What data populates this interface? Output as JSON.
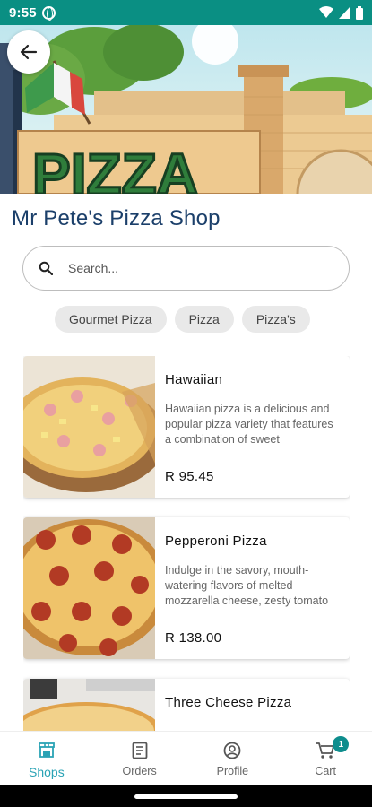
{
  "status_bar": {
    "time": "9:55",
    "globe_icon": "globe-icon",
    "wifi_icon": "wifi-icon",
    "signal_icon": "signal-icon",
    "battery_icon": "battery-icon"
  },
  "hero": {
    "banner_text": "PIZZA",
    "back_icon": "arrow-left-icon"
  },
  "shop": {
    "title": "Mr Pete's Pizza Shop"
  },
  "search": {
    "placeholder": "Search...",
    "value": "",
    "icon": "search-icon"
  },
  "chips": [
    "Gourmet Pizza",
    "Pizza",
    "Pizza's"
  ],
  "products": [
    {
      "name": "Hawaiian",
      "description": "Hawaiian pizza is a delicious and popular pizza variety that features a combination of sweet",
      "price": "R 95.45"
    },
    {
      "name": "Pepperoni Pizza",
      "description": "Indulge in the savory, mouth-watering flavors of melted mozzarella cheese, zesty tomato",
      "price": "R 138.00"
    },
    {
      "name": "Three Cheese Pizza",
      "description": "",
      "price": ""
    }
  ],
  "bottom_nav": {
    "items": [
      {
        "label": "Shops",
        "icon": "storefront-icon",
        "active": true
      },
      {
        "label": "Orders",
        "icon": "receipt-icon",
        "active": false
      },
      {
        "label": "Profile",
        "icon": "person-circle-icon",
        "active": false
      },
      {
        "label": "Cart",
        "icon": "cart-icon",
        "active": false
      }
    ],
    "cart_badge": "1"
  },
  "colors": {
    "status_bar": "#0a8f83",
    "title": "#1b3f6a",
    "active_nav": "#2aa3b5",
    "badge": "#0e8d8d"
  }
}
